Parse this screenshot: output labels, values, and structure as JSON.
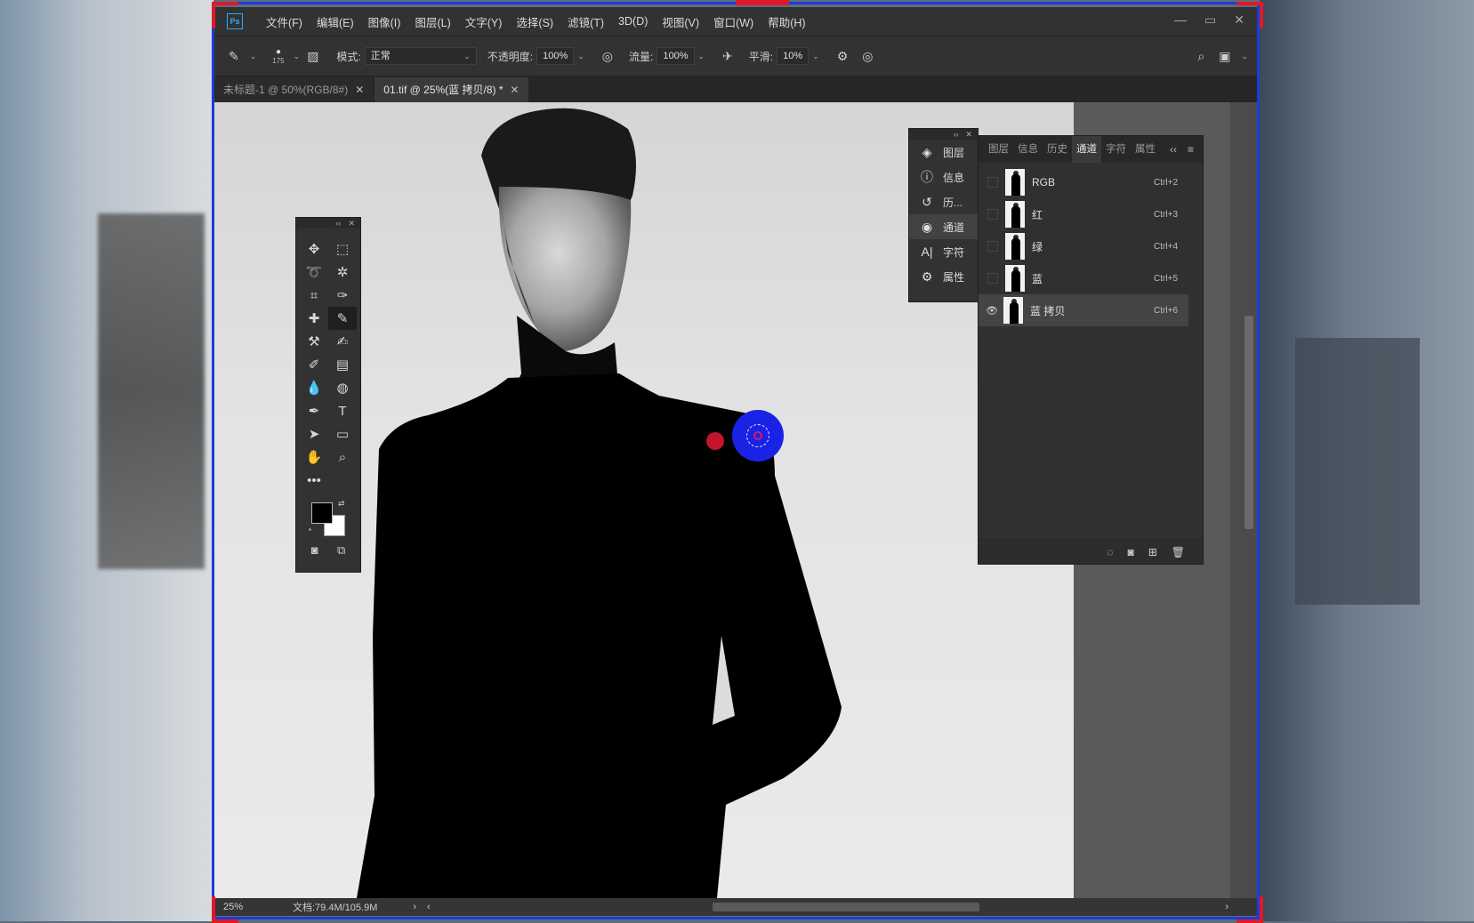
{
  "menubar": {
    "logo": "Ps",
    "items": [
      "文件(F)",
      "编辑(E)",
      "图像(I)",
      "图层(L)",
      "文字(Y)",
      "选择(S)",
      "滤镜(T)",
      "3D(D)",
      "视图(V)",
      "窗口(W)",
      "帮助(H)"
    ],
    "window_controls": [
      "—",
      "▭",
      "✕"
    ]
  },
  "options": {
    "brush_size": "175",
    "mode_label": "模式:",
    "mode_value": "正常",
    "opacity_label": "不透明度:",
    "opacity_value": "100%",
    "flow_label": "流量:",
    "flow_value": "100%",
    "smoothing_label": "平滑:",
    "smoothing_value": "10%"
  },
  "tabs": [
    {
      "label": "未标题-1 @ 50%(RGB/8#)",
      "close": "✕"
    },
    {
      "label": "01.tif @ 25%(蓝 拷贝/8) *",
      "close": "✕"
    }
  ],
  "dock": {
    "items": [
      {
        "icon": "layers-icon",
        "glyph": "◈",
        "label": "图层"
      },
      {
        "icon": "info-icon",
        "glyph": "ⓘ",
        "label": "信息"
      },
      {
        "icon": "history-icon",
        "glyph": "↺",
        "label": "历..."
      },
      {
        "icon": "channels-icon",
        "glyph": "◉",
        "label": "通道"
      },
      {
        "icon": "character-icon",
        "glyph": "A|",
        "label": "字符"
      },
      {
        "icon": "properties-icon",
        "glyph": "⚙",
        "label": "属性"
      }
    ]
  },
  "channels_panel": {
    "tabs": [
      "图层",
      "信息",
      "历史",
      "通道",
      "字符",
      "属性"
    ],
    "rows": [
      {
        "name": "RGB",
        "shortcut": "Ctrl+2",
        "visible": false
      },
      {
        "name": "红",
        "shortcut": "Ctrl+3",
        "visible": false
      },
      {
        "name": "绿",
        "shortcut": "Ctrl+4",
        "visible": false
      },
      {
        "name": "蓝",
        "shortcut": "Ctrl+5",
        "visible": false
      },
      {
        "name": "蓝 拷贝",
        "shortcut": "Ctrl+6",
        "visible": true
      }
    ]
  },
  "status": {
    "zoom": "25%",
    "doc_size": "文档:79.4M/105.9M"
  },
  "colors": {
    "frame_blue": "#1d3bd8",
    "corner_red": "#e0192a",
    "brush_blue": "#1a22e6",
    "foreground": "#000000",
    "background": "#ffffff"
  }
}
